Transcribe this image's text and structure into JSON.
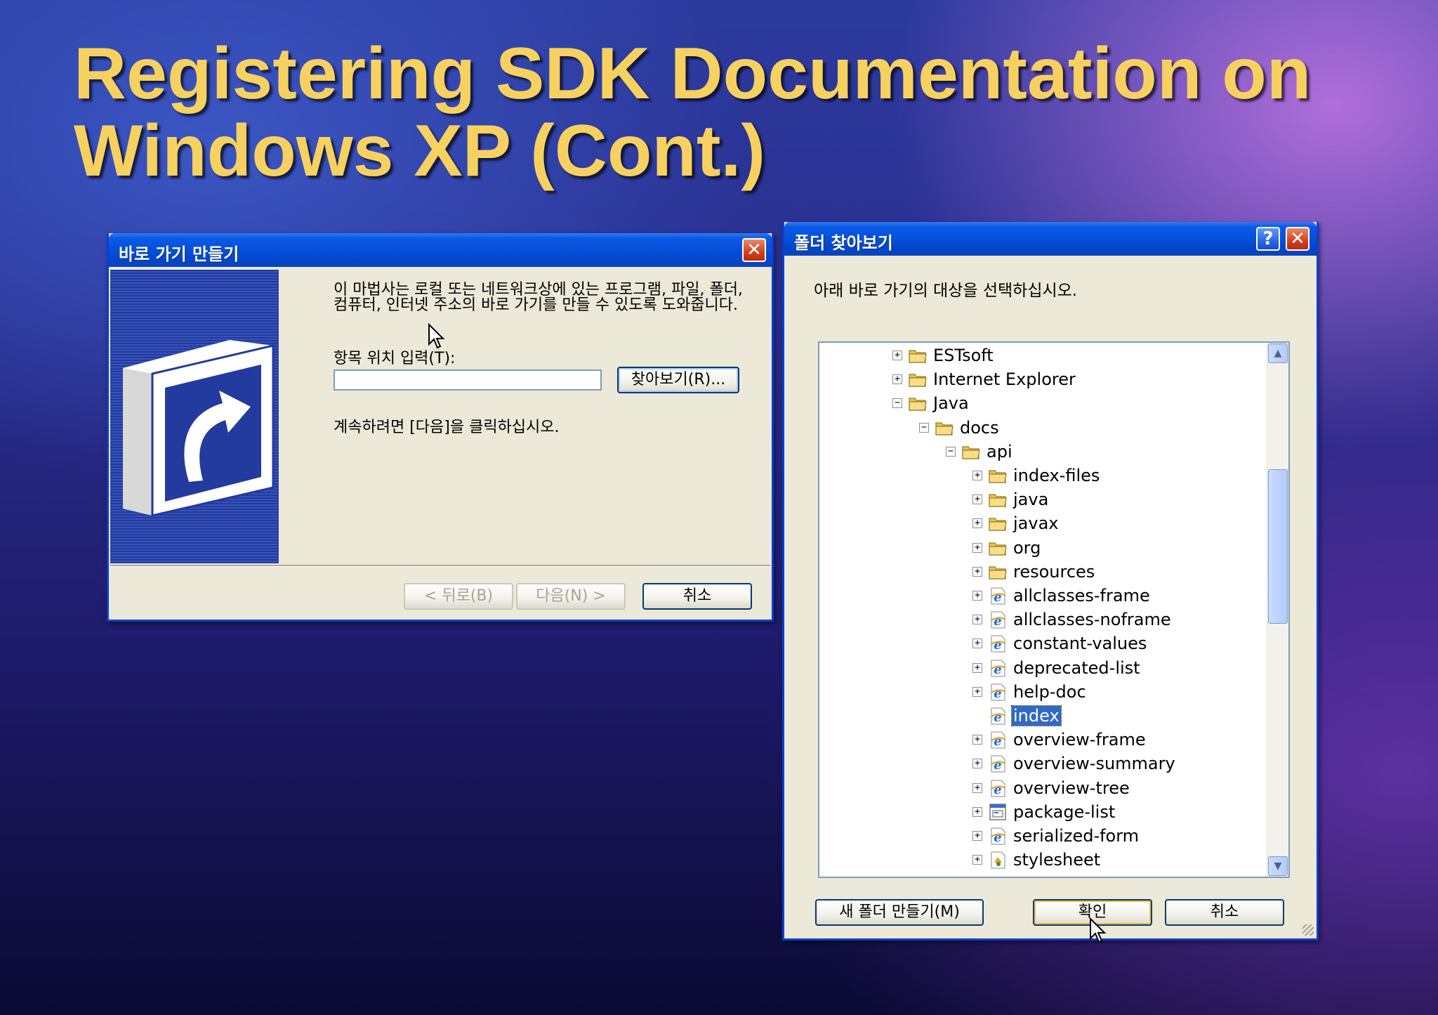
{
  "slide": {
    "title_line1": "Registering SDK Documentation on",
    "title_line2": "Windows XP (Cont.)"
  },
  "shortcut_wizard": {
    "title": "바로 가기 만들기",
    "description": "이 마법사는 로컬 또는 네트워크상에 있는 프로그램, 파일, 폴더, 컴퓨터, 인터넷 주소의 바로 가기를 만들 수 있도록 도와줍니다.",
    "location_label": "항목 위치 입력(T):",
    "location_value": "",
    "browse_button": "찾아보기(R)...",
    "continue_text": "계속하려면 [다음]을 클릭하십시오.",
    "back_button": "< 뒤로(B)",
    "next_button": "다음(N) >",
    "cancel_button": "취소",
    "icon": "shortcut-arrow-icon"
  },
  "browse_dialog": {
    "title": "폴더 찾아보기",
    "prompt": "아래 바로 가기의 대상을 선택하십시오.",
    "tree": [
      {
        "label": "ESTsoft",
        "level": 0,
        "expander": "+",
        "icon": "folder-icon"
      },
      {
        "label": "Internet Explorer",
        "level": 0,
        "expander": "+",
        "icon": "folder-icon"
      },
      {
        "label": "Java",
        "level": 0,
        "expander": "−",
        "icon": "folder-icon"
      },
      {
        "label": "docs",
        "level": 1,
        "expander": "−",
        "icon": "folder-icon"
      },
      {
        "label": "api",
        "level": 2,
        "expander": "−",
        "icon": "folder-icon"
      },
      {
        "label": "index-files",
        "level": 3,
        "expander": "+",
        "icon": "folder-icon"
      },
      {
        "label": "java",
        "level": 3,
        "expander": "+",
        "icon": "folder-icon"
      },
      {
        "label": "javax",
        "level": 3,
        "expander": "+",
        "icon": "folder-icon"
      },
      {
        "label": "org",
        "level": 3,
        "expander": "+",
        "icon": "folder-icon"
      },
      {
        "label": "resources",
        "level": 3,
        "expander": "+",
        "icon": "folder-icon"
      },
      {
        "label": "allclasses-frame",
        "level": 3,
        "expander": "+",
        "icon": "ie-html-icon"
      },
      {
        "label": "allclasses-noframe",
        "level": 3,
        "expander": "+",
        "icon": "ie-html-icon"
      },
      {
        "label": "constant-values",
        "level": 3,
        "expander": "+",
        "icon": "ie-html-icon"
      },
      {
        "label": "deprecated-list",
        "level": 3,
        "expander": "+",
        "icon": "ie-html-icon"
      },
      {
        "label": "help-doc",
        "level": 3,
        "expander": "+",
        "icon": "ie-html-icon"
      },
      {
        "label": "index",
        "level": 3,
        "expander": "",
        "icon": "ie-html-icon",
        "selected": true
      },
      {
        "label": "overview-frame",
        "level": 3,
        "expander": "+",
        "icon": "ie-html-icon"
      },
      {
        "label": "overview-summary",
        "level": 3,
        "expander": "+",
        "icon": "ie-html-icon"
      },
      {
        "label": "overview-tree",
        "level": 3,
        "expander": "+",
        "icon": "ie-html-icon"
      },
      {
        "label": "package-list",
        "level": 3,
        "expander": "+",
        "icon": "file-icon"
      },
      {
        "label": "serialized-form",
        "level": 3,
        "expander": "+",
        "icon": "ie-html-icon"
      },
      {
        "label": "stylesheet",
        "level": 3,
        "expander": "+",
        "icon": "stylesheet-icon"
      }
    ],
    "new_folder_button": "새 폴더 만들기(M)",
    "ok_button": "확인",
    "cancel_button": "취소",
    "help_button": "?",
    "close_button": "✕"
  },
  "colors": {
    "title_yellow": "#f7d160",
    "xp_blue": "#0650d8",
    "selection": "#316ac5"
  }
}
